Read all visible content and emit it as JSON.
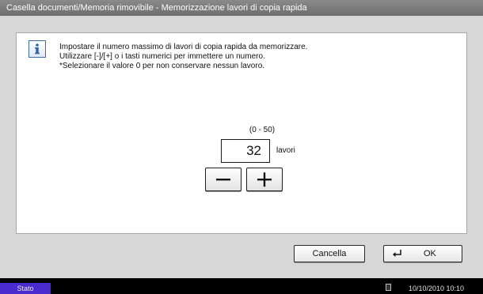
{
  "window": {
    "title": "Casella documenti/Memoria rimovibile - Memorizzazione lavori di copia rapida"
  },
  "info": {
    "icon": "info-icon",
    "lines": [
      "Impostare il numero massimo di lavori di copia rapida da memorizzare.",
      "Utilizzare [-]/[+] o i tasti numerici per immettere un numero.",
      "*Selezionare il valore 0 per non conservare nessun lavoro."
    ]
  },
  "input": {
    "range": "(0 - 50)",
    "value": "32",
    "unit": "lavori"
  },
  "buttons": {
    "minus": "minus-icon",
    "plus": "plus-icon",
    "cancel": "Cancella",
    "ok": "OK",
    "ok_icon": "enter-icon"
  },
  "status_bar": {
    "status": "Stato",
    "datetime": "10/10/2010  10:10",
    "media_icon": "memory-card-icon"
  },
  "colors": {
    "title_bar": "#7a7a7a",
    "background": "#d7d7d7",
    "status_tab": "#4a2bd0",
    "info_icon": "#2d63a8"
  }
}
